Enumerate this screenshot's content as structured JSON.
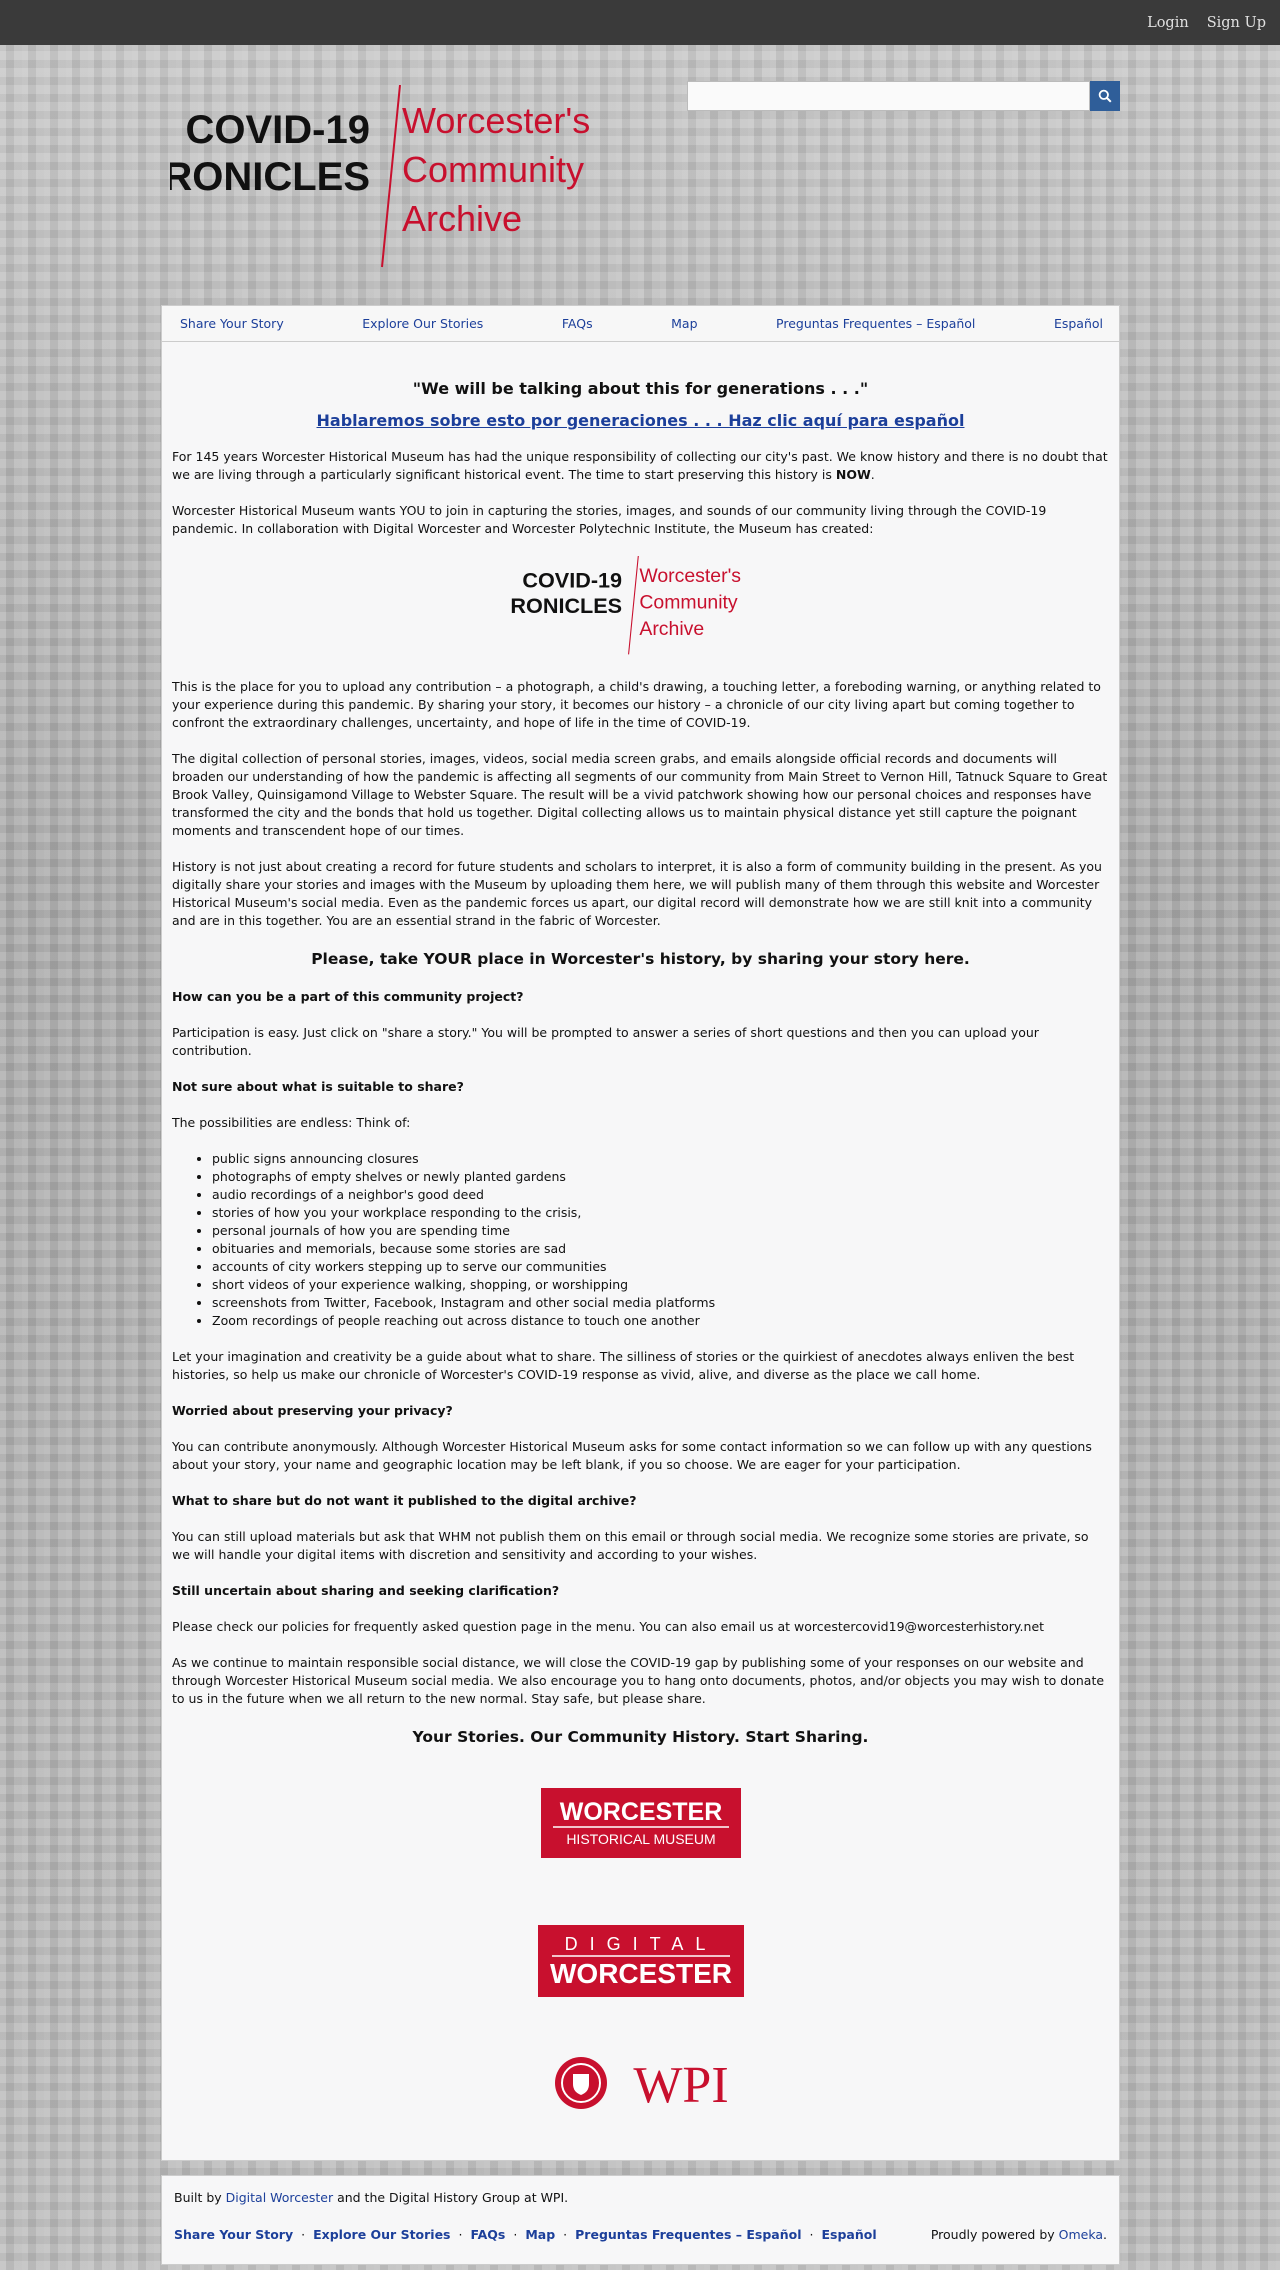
{
  "topbar": {
    "login": "Login",
    "signup": "Sign Up"
  },
  "logo": {
    "line1": "COVID-19",
    "line2": "CHRONICLES",
    "right1": "Worcester's",
    "right2": "Community",
    "right3": "Archive"
  },
  "search": {
    "placeholder": ""
  },
  "nav": {
    "items": [
      "Share Your Story",
      "Explore Our Stories",
      "FAQs",
      "Map",
      "Preguntas Frequentes – Español",
      "Español"
    ]
  },
  "main": {
    "heading": "\"We will be talking about this for generations . . .\"",
    "spanish_link": "Hablaremos sobre esto por generaciones . . . Haz clic aquí para español",
    "p1_a": "For 145 years Worcester Historical Museum has had the unique responsibility of collecting our city's past. We know history and there is no doubt that we are living through a particularly significant historical event. The time to start preserving this history is ",
    "p1_now": "NOW",
    "p1_end": ".",
    "p2": "Worcester Historical Museum wants YOU to join in capturing the stories, images, and sounds of our community living through the COVID-19 pandemic. In collaboration with Digital Worcester and Worcester Polytechnic Institute, the Museum has created:",
    "p3": "This is the place for you to upload any contribution – a photograph, a child's drawing, a touching letter, a foreboding warning, or anything related to your experience during this pandemic. By sharing your story, it becomes our history – a chronicle of our city living apart but coming together to confront the extraordinary challenges, uncertainty, and hope of life in the time of COVID-19.",
    "p4": "The digital collection of personal stories, images, videos, social media screen grabs, and emails alongside official records and documents will broaden our understanding of how the pandemic is affecting all segments of our community from Main Street to Vernon Hill, Tatnuck Square to Great Brook Valley, Quinsigamond Village to Webster Square. The result will be a vivid patchwork showing how our personal choices and responses have transformed the city and the bonds that hold us together. Digital collecting allows us to maintain physical distance yet still capture the poignant moments and transcendent hope of our times.",
    "p5": "History is not just about creating a record for future students and scholars to interpret, it is also a form of community building in the present. As you digitally share your stories and images with the Museum by uploading them here, we will publish many of them through this website and Worcester Historical Museum's social media. Even as the pandemic forces us apart, our digital record will demonstrate how we are still knit into a community and are in this together. You are an essential strand in the fabric of Worcester.",
    "heading2": "Please, take YOUR place in Worcester's history, by sharing your story here.",
    "q1": "How can you be a part of this community project?",
    "a1": "Participation is easy. Just click on \"share a story.\" You will be prompted to answer a series of short questions and then you can upload your contribution.",
    "q2": "Not sure about what is suitable to share?",
    "a2": "The possibilities are endless: Think of:",
    "list": [
      "public signs announcing closures",
      "photographs of empty shelves or newly planted gardens",
      "audio recordings of a neighbor's good deed",
      "stories of how you your workplace responding to the crisis,",
      "personal journals of how you are spending time",
      "obituaries and memorials, because some stories are sad",
      "accounts of city workers stepping up to serve our communities",
      "short videos of your experience walking, shopping, or worshipping",
      "screenshots from Twitter, Facebook, Instagram and other social media platforms",
      "Zoom recordings of people reaching out across distance to touch one another"
    ],
    "p6": "Let your imagination and creativity be a guide about what to share. The silliness of stories or the quirkiest of anecdotes always enliven the best histories, so help us make our chronicle of Worcester's COVID-19 response as vivid, alive, and diverse as the place we call home.",
    "q3": "Worried about preserving your privacy?",
    "a3": "You can contribute anonymously. Although Worcester Historical Museum asks for some contact information so we can follow up with any questions about your story, your name and geographic location may be left blank, if you so choose. We are eager for your participation.",
    "q4": "What to share but do not want it published to the digital archive?",
    "a4": "You can still upload materials but ask that WHM not publish them on this email or through social media. We recognize some stories are private, so we will handle your digital items with discretion and sensitivity and according to your wishes.",
    "q5": "Still uncertain about sharing and seeking clarification?",
    "a5": "Please check our policies for frequently asked question page in the menu. You can also email us at worcestercovid19@worcesterhistory.net",
    "p7": "As we continue to maintain responsible social distance, we will close the COVID-19 gap by publishing some of your responses on our website and through Worcester Historical Museum social media.  We also encourage you to hang onto documents, photos, and/or objects you may wish to donate to us in the future when we all return to the new normal.  Stay safe, but please share.",
    "heading3": "Your Stories. Our Community History. Start Sharing."
  },
  "partners": {
    "whm1": "WORCESTER",
    "whm2": "HISTORICAL MUSEUM",
    "dw1": "DIGITAL",
    "dw2": "WORCESTER",
    "wpi": "WPI"
  },
  "footer": {
    "built_pre": "Built by ",
    "built_link": "Digital Worcester",
    "built_post": " and the Digital History Group at WPI.",
    "links": [
      "Share Your Story",
      "Explore Our Stories",
      "FAQs",
      "Map",
      "Preguntas Frequentes – Español",
      "Español"
    ],
    "powered_pre": "Proudly powered by ",
    "powered_link": "Omeka",
    "powered_post": "."
  },
  "colors": {
    "brand_red": "#c8102e",
    "link_blue": "#1c3f9a",
    "search_blue": "#2f5e99"
  }
}
